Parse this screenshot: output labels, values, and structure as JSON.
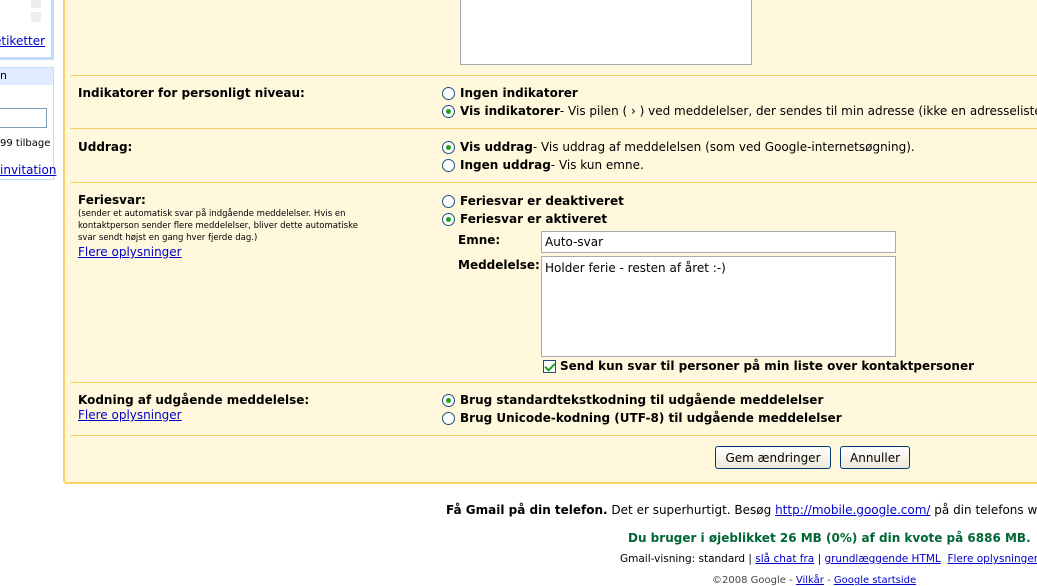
{
  "sidebar": {
    "labels_link": "etiketter",
    "chat": {
      "header": "n",
      "left_text": "99 tilbage",
      "invite_link": "invitation"
    }
  },
  "settings": {
    "personal_indicators": {
      "label": "Indikatorer for personligt niveau:",
      "options": [
        {
          "label": "Ingen indikatorer",
          "desc": "",
          "selected": false
        },
        {
          "label": "Vis indikatorer",
          "desc": " - Vis pilen ( › ) ved meddelelser, der sendes til min adresse (ikke en adresseliste), og",
          "selected": true
        }
      ]
    },
    "snippets": {
      "label": "Uddrag:",
      "options": [
        {
          "label": "Vis uddrag",
          "desc": " - Vis uddrag af meddelelsen (som ved Google-internetsøgning).",
          "selected": true
        },
        {
          "label": "Ingen uddrag",
          "desc": " - Vis kun emne.",
          "selected": false
        }
      ]
    },
    "vacation": {
      "label": "Feriesvar:",
      "sub": "(sender et automatisk svar på indgående meddelelser. Hvis en kontaktperson sender flere meddelelser, bliver dette automatiske svar sendt højst en gang hver fjerde dag.)",
      "more_link": "Flere oplysninger",
      "options": [
        {
          "label": "Feriesvar er deaktiveret",
          "selected": false
        },
        {
          "label": "Feriesvar er aktiveret",
          "selected": true
        }
      ],
      "subject_label": "Emne:",
      "subject_value": "Auto-svar",
      "message_label": "Meddelelse:",
      "message_value": "Holder ferie - resten af året :-)",
      "contacts_only_label": "Send kun svar til personer på min liste over kontaktpersoner",
      "contacts_only_checked": true
    },
    "encoding": {
      "label": "Kodning af udgående meddelelse:",
      "more_link": "Flere oplysninger",
      "options": [
        {
          "label": "Brug standardtekstkodning til udgående meddelelser",
          "selected": true
        },
        {
          "label": "Brug Unicode-kodning (UTF-8) til udgående meddelelser",
          "selected": false
        }
      ]
    },
    "buttons": {
      "save": "Gem ændringer",
      "cancel": "Annuller"
    }
  },
  "footer": {
    "mobile_bold": "Få Gmail på din telefon.",
    "mobile_text": " Det er superhurtigt. Besøg ",
    "mobile_link": "http://mobile.google.com/",
    "mobile_after": " på din telefons webbro",
    "quota": "Du bruger i øjeblikket 26 MB (0%) af din kvote på 6886 MB.",
    "view_prefix": "Gmail-visning: standard | ",
    "chat_off_link": "slå chat fra",
    "sep": " | ",
    "basic_html_link": "grundlæggende HTML",
    "more_link": "Flere oplysninger",
    "copyright": "©2008 Google - ",
    "terms_link": "Vilkår",
    "google_home_link": "Google startside"
  },
  "colors": {
    "panel_bg": "#fff8dc",
    "panel_border": "#fad163",
    "link": "#0000cc",
    "quota_green": "#006633"
  }
}
